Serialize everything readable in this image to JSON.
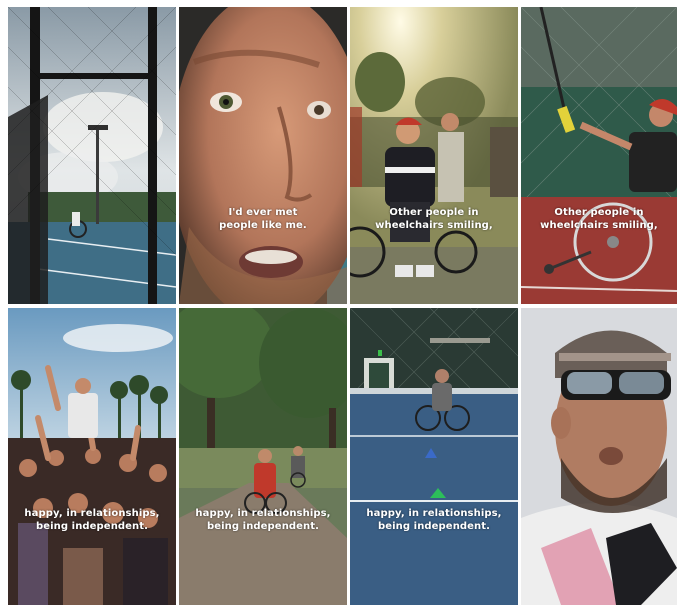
{
  "colors": {
    "court_blue": "#3f6e86",
    "court_red": "#9a3a34",
    "sky_light": "#d6dde2",
    "skin": "#c98c6c",
    "foliage": "#4a6a3a",
    "caption_text": "#ffffff"
  },
  "frames": [
    {
      "lines": []
    },
    {
      "lines": [
        "I'd ever met",
        "people like me."
      ]
    },
    {
      "lines": [
        "Other people in",
        "wheelchairs smiling,"
      ]
    },
    {
      "lines": [
        "Other people in",
        "wheelchairs smiling,"
      ]
    },
    {
      "lines": [
        "happy, in relationships,",
        "being independent."
      ]
    },
    {
      "lines": [
        "happy, in relationships,",
        "being independent."
      ]
    },
    {
      "lines": [
        "happy, in relationships,",
        "being independent."
      ]
    },
    {
      "lines": []
    }
  ]
}
